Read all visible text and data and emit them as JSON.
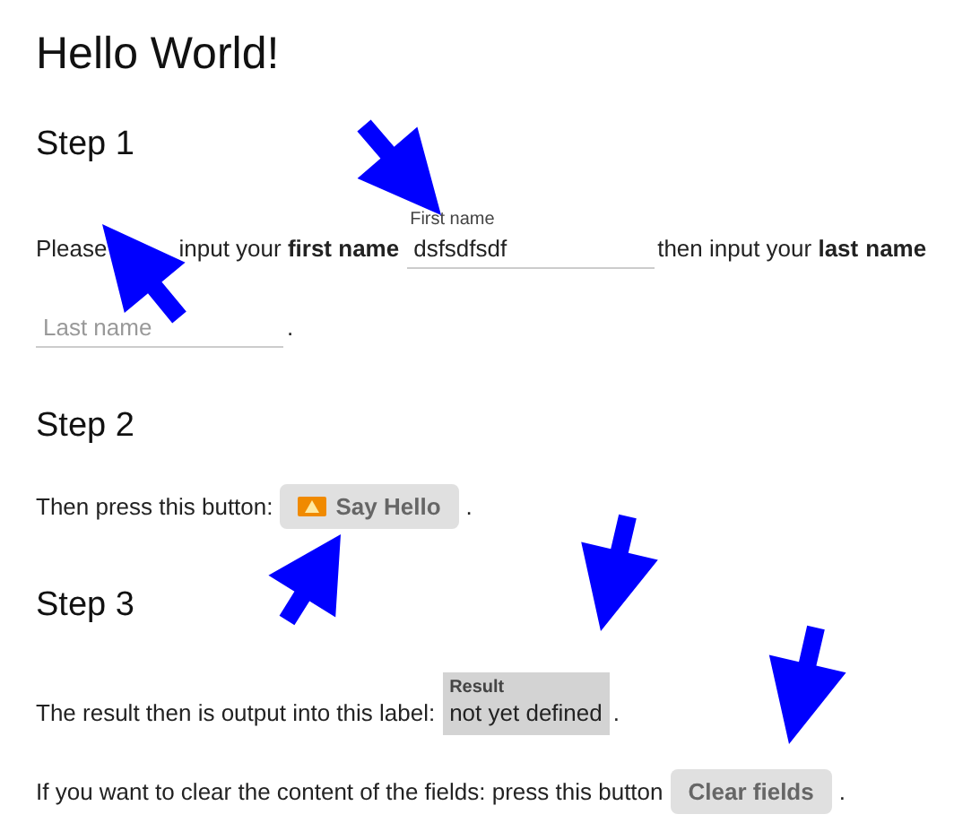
{
  "page": {
    "title": "Hello World!"
  },
  "steps": [
    {
      "heading": "Step 1",
      "lines": [
        [
          {
            "kind": "text",
            "text": "Please"
          },
          {
            "kind": "text",
            "text": "input your **first name**"
          },
          {
            "kind": "field",
            "label": "First name",
            "value": "dsfsdfsdf"
          },
          {
            "kind": "text",
            "text": "then input your **last**"
          },
          {
            "kind": "text",
            "text": "**name**"
          },
          {
            "kind": "field",
            "placeholder": "Last name"
          },
          {
            "kind": "text",
            "text": "."
          }
        ]
      ]
    },
    {
      "heading": "Step 2",
      "lines": [
        [
          {
            "kind": "text",
            "text": "Then press this button:"
          },
          {
            "kind": "icon-button",
            "label": "Say Hello"
          },
          {
            "kind": "text",
            "text": "."
          }
        ]
      ]
    },
    {
      "heading": "Step 3",
      "lines": [
        [
          {
            "kind": "text",
            "text": "The result then is output into this label:"
          },
          {
            "kind": "output",
            "label": "Result",
            "value": "not yet defined"
          },
          {
            "kind": "text",
            "text": "."
          }
        ],
        [
          {
            "kind": "text",
            "text": "If you want to clear the content of the fields: press this button"
          },
          {
            "kind": "button",
            "label": "Clear fields"
          },
          {
            "kind": "text",
            "text": "."
          }
        ]
      ]
    }
  ]
}
